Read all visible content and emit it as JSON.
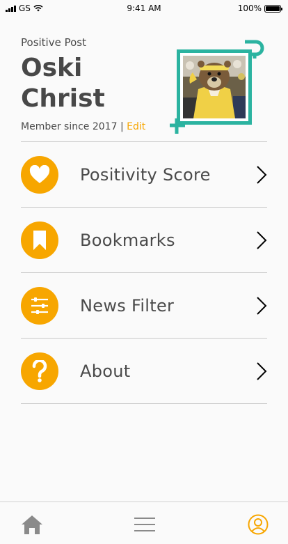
{
  "status_bar": {
    "carrier": "GS",
    "time": "9:41 AM",
    "battery": "100%"
  },
  "header": {
    "app_name": "Positive Post",
    "user_first": "Oski",
    "user_last": "Christ",
    "member_since": "Member since 2017",
    "separator": "|",
    "edit_label": "Edit"
  },
  "menu": {
    "items": [
      {
        "label": "Positivity Score",
        "icon": "heart-icon"
      },
      {
        "label": "Bookmarks",
        "icon": "bookmark-icon"
      },
      {
        "label": "News Filter",
        "icon": "sliders-icon"
      },
      {
        "label": "About",
        "icon": "question-icon"
      }
    ]
  },
  "tab_bar": {
    "tabs": [
      {
        "icon": "home-icon",
        "active": false
      },
      {
        "icon": "menu-icon",
        "active": false
      },
      {
        "icon": "profile-icon",
        "active": true
      }
    ]
  },
  "colors": {
    "accent": "#f7a600",
    "brand_teal": "#2bb3a0",
    "text": "#4a4a4a",
    "divider": "#c8c8c8"
  }
}
